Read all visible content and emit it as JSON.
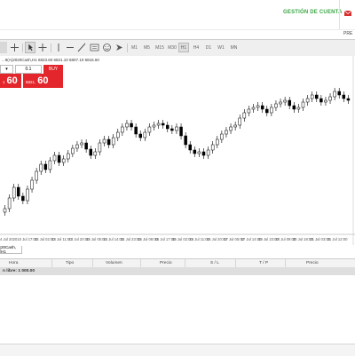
{
  "header": {
    "account_link": "GESTIÓN DE CUENTA",
    "mail_icon": "mail-icon",
    "menu_partial": "PRE"
  },
  "toolbar": {
    "tools": [
      "crosshair-icon",
      "cursor-icon",
      "crosshair-plus-icon",
      "vertical-line-icon",
      "horizontal-line-icon",
      "trend-line-icon",
      "text-icon",
      "smiley-icon",
      "arrow-icon"
    ],
    "timeframes": [
      "M1",
      "M5",
      "M15",
      "M30",
      "H1",
      "H4",
      "D1",
      "W1",
      "MN"
    ],
    "active_timeframe": "H1"
  },
  "chart": {
    "ohlc_text": "...9(A)2020Cash,H1  6823.60 6821.10 6807.10 6816.60",
    "volume": "0.1",
    "sell_label": "",
    "buy_label": "BUY",
    "sell_small": "1",
    "sell_big": "60",
    "buy_small": "6821.",
    "buy_big": "60",
    "x_labels": [
      "4 Jul 2020",
      "10 Jul 17:00",
      "13 Jul 02:00",
      "13 Jul 11:00",
      "13 Jul 20:00",
      "14 Jul 05:00",
      "14 Jul 14:00",
      "14 Jul 23:00",
      "15 Jul 08:00",
      "15 Jul 17:00",
      "16 Jul 02:00",
      "16 Jul 11:00",
      "16 Jul 20:00",
      "17 Jul 05:00",
      "17 Jul 14:00",
      "19 Jul 23:00",
      "20 Jul 09:00",
      "20 Jul 18:00",
      "21 Jul 03:00",
      "21 Jul 12:00"
    ],
    "colors": {
      "bull": "#ffffff",
      "bear": "#000000",
      "outline": "#000000",
      "sell": "#e3262b",
      "buy": "#e3262b"
    }
  },
  "chart_tab": {
    "label": "20Cash, H1"
  },
  "orders_table": {
    "columns": [
      "Hora",
      "Tipo",
      "Volumen",
      "Precio",
      "S / L",
      "T / P",
      "Precio"
    ],
    "summary": "n libre: 1 000.00"
  }
}
